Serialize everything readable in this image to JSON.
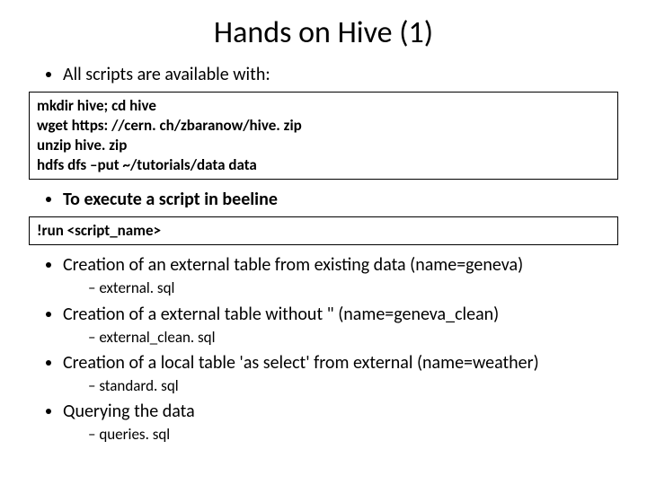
{
  "title": "Hands on Hive (1)",
  "bullets": {
    "intro": "All scripts are available with:",
    "execLabel": "To execute a script in beeline",
    "b3": "Creation of an external table from existing data (name=geneva)",
    "b3sub": "external. sql",
    "b4": "Creation of a external table without \" (name=geneva_clean)",
    "b4sub": "external_clean. sql",
    "b5": "Creation of a local table 'as select' from external (name=weather)",
    "b5sub": "standard. sql",
    "b6": "Querying the data",
    "b6sub": "queries. sql"
  },
  "code1": {
    "l1": "mkdir hive; cd hive",
    "l2": "wget https: //cern. ch/zbaranow/hive. zip",
    "l3": "unzip hive. zip",
    "l4": "hdfs dfs –put ~/tutorials/data data"
  },
  "code2": {
    "l1": "!run <script_name>"
  }
}
